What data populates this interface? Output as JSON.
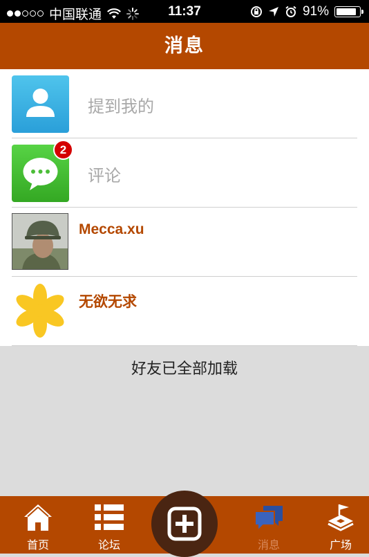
{
  "status_bar": {
    "carrier": "中国联通",
    "time": "11:37",
    "battery_percent": "91%",
    "battery_level": 0.91
  },
  "nav": {
    "title": "消息"
  },
  "list": [
    {
      "label": "提到我的",
      "icon": "user-icon"
    },
    {
      "label": "评论",
      "icon": "chat-bubble-icon",
      "badge": "2"
    },
    {
      "label": "Mecca.xu",
      "icon": "avatar-soldier"
    },
    {
      "label": "无欲无求",
      "icon": "avatar-flower"
    }
  ],
  "footer_message": "好友已全部加载",
  "tabs": [
    {
      "label": "首页",
      "icon": "home-icon"
    },
    {
      "label": "论坛",
      "icon": "list-icon"
    },
    {
      "label": "",
      "icon": "add-icon"
    },
    {
      "label": "消息",
      "icon": "message-icon",
      "active": true
    },
    {
      "label": "广场",
      "icon": "plaza-icon"
    }
  ],
  "colors": {
    "brand": "#b44800",
    "badge": "#d40000",
    "name_text": "#b44800"
  }
}
